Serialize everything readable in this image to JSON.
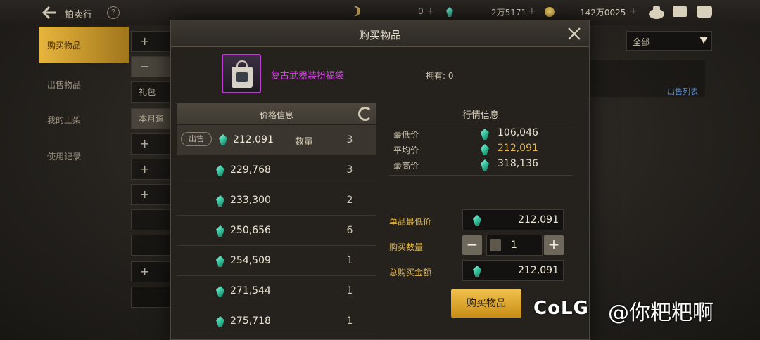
{
  "topbar": {
    "title": "拍卖行",
    "help": "?",
    "currency1": "0",
    "currency2": "2万5171",
    "currency3": "142万0025",
    "plus": "+"
  },
  "nav": {
    "items": [
      "购买物品",
      "出售物品",
      "我的上架",
      "使用记录"
    ]
  },
  "background": {
    "row_plus": "+",
    "row_minus": "−",
    "label_gift": "礼包",
    "label_month": "本月道",
    "select_value": "全部",
    "link": "出售列表"
  },
  "modal": {
    "title": "购买物品",
    "item_name": "复古武器装扮福袋",
    "owned": "拥有: 0",
    "price_header": "价格信息",
    "sell_tag": "出售",
    "qty_label": "数量",
    "listings": [
      {
        "price": "212,091",
        "qty": "3"
      },
      {
        "price": "229,768",
        "qty": "3"
      },
      {
        "price": "233,300",
        "qty": "2"
      },
      {
        "price": "250,656",
        "qty": "6"
      },
      {
        "price": "254,509",
        "qty": "1"
      },
      {
        "price": "271,544",
        "qty": "1"
      },
      {
        "price": "275,718",
        "qty": "1"
      }
    ],
    "market": {
      "header": "行情信息",
      "lowest_label": "最低价",
      "lowest": "106,046",
      "avg_label": "平均价",
      "avg": "212,091",
      "highest_label": "最高价",
      "highest": "318,136"
    },
    "form": {
      "unit_label": "单品最低价",
      "unit_price": "212,091",
      "qty_label": "购买数量",
      "qty": "1",
      "minus": "−",
      "plus": "+",
      "total_label": "总购买金额",
      "total": "212,091",
      "buy_button": "购买物品"
    }
  },
  "watermark": {
    "logo": "CoLG",
    "user": "@你粑粑啊"
  }
}
